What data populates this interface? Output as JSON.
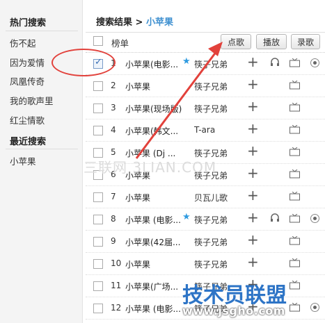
{
  "sidebar": {
    "hot_title": "热门搜索",
    "hot_items": [
      "伤不起",
      "因为爱情",
      "凤凰传奇",
      "我的歌声里",
      "红尘情歌"
    ],
    "recent_title": "最近搜索",
    "recent_items": [
      "小苹果"
    ]
  },
  "breadcrumb": {
    "prefix": "搜索结果 >",
    "current": "小苹果"
  },
  "list_header": {
    "column_label": "榜单",
    "buttons": {
      "order": "点歌",
      "play": "播放",
      "record": "录歌"
    }
  },
  "rows": [
    {
      "num": "1",
      "title": "小苹果(电影...",
      "starred": true,
      "artist": "筷子兄弟",
      "has_headphones": true,
      "has_radio": true,
      "checked": true
    },
    {
      "num": "2",
      "title": "小苹果",
      "starred": false,
      "artist": "筷子兄弟",
      "has_headphones": false,
      "has_radio": false,
      "checked": false
    },
    {
      "num": "3",
      "title": "小苹果(现场版)",
      "starred": false,
      "artist": "筷子兄弟",
      "has_headphones": false,
      "has_radio": false,
      "checked": false
    },
    {
      "num": "4",
      "title": "小苹果(韩文...",
      "starred": false,
      "artist": "T-ara",
      "has_headphones": false,
      "has_radio": false,
      "checked": false
    },
    {
      "num": "5",
      "title": "小苹果 (Dj ...",
      "starred": false,
      "artist": "筷子兄弟",
      "has_headphones": false,
      "has_radio": false,
      "checked": false
    },
    {
      "num": "6",
      "title": "小苹果",
      "starred": false,
      "artist": "筷子兄弟",
      "has_headphones": false,
      "has_radio": false,
      "checked": false
    },
    {
      "num": "7",
      "title": "小苹果",
      "starred": false,
      "artist": "贝瓦儿歌",
      "has_headphones": false,
      "has_radio": false,
      "checked": false
    },
    {
      "num": "8",
      "title": "小苹果 (电影...",
      "starred": true,
      "artist": "筷子兄弟",
      "has_headphones": true,
      "has_radio": true,
      "checked": false
    },
    {
      "num": "9",
      "title": "小苹果(42届...",
      "starred": false,
      "artist": "筷子兄弟",
      "has_headphones": false,
      "has_radio": false,
      "checked": false
    },
    {
      "num": "10",
      "title": "小苹果",
      "starred": false,
      "artist": "筷子兄弟",
      "has_headphones": false,
      "has_radio": false,
      "checked": false
    },
    {
      "num": "11",
      "title": "小苹果(广场...",
      "starred": false,
      "artist": "筷子兄弟",
      "has_headphones": false,
      "has_radio": false,
      "checked": false
    },
    {
      "num": "12",
      "title": "小苹果 (电影...",
      "starred": false,
      "artist": "筷子兄弟",
      "has_headphones": false,
      "has_radio": true,
      "checked": false
    }
  ],
  "watermarks": {
    "left": "三联网 3LIAN.COM",
    "right": "技术员联盟",
    "url": "www.jsgho.com"
  },
  "colors": {
    "accent": "#3d8fd0",
    "annotation": "#e2413b",
    "star": "#2f9be0"
  }
}
